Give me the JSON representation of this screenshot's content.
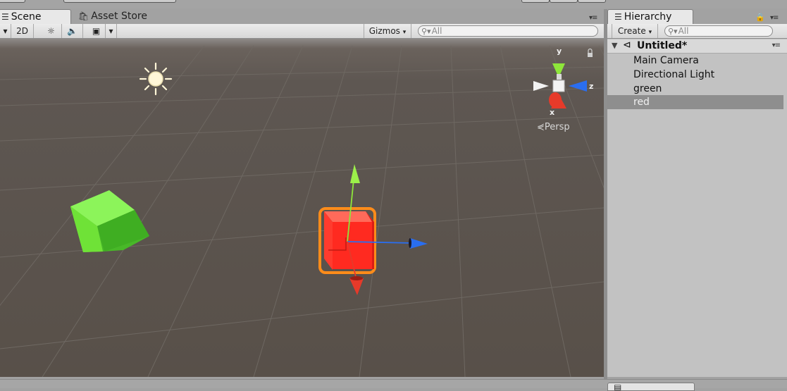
{
  "tabs": {
    "scene": "Scene",
    "asset_store": "Asset Store",
    "hierarchy": "Hierarchy"
  },
  "scene_toolbar": {
    "mode_2d": "2D",
    "gizmos": "Gizmos",
    "search_placeholder": "All"
  },
  "scene_view": {
    "projection_label": "Persp",
    "axis_labels": {
      "y": "y",
      "z": "z",
      "x": "x"
    }
  },
  "hierarchy": {
    "create_label": "Create",
    "search_placeholder": "All",
    "scene_name": "Untitled*",
    "items": [
      {
        "label": "Main Camera",
        "selected": false
      },
      {
        "label": "Directional Light",
        "selected": false
      },
      {
        "label": "green",
        "selected": false
      },
      {
        "label": "red",
        "selected": true
      }
    ]
  },
  "colors": {
    "selection_outline": "#ff8c1a",
    "red_cube": "#ff2a20",
    "green_cube": "#6be83a",
    "y_axis": "#8ee63a",
    "z_axis": "#2a6ef0",
    "x_axis": "#e63a2a"
  },
  "icons": [
    "scene-tab-icon",
    "asset-store-icon",
    "lighting-icon",
    "audio-icon",
    "effects-icon",
    "hierarchy-icon",
    "lock-icon",
    "panel-menu-icon",
    "unity-scene-icon",
    "search-icon",
    "sun-icon"
  ]
}
